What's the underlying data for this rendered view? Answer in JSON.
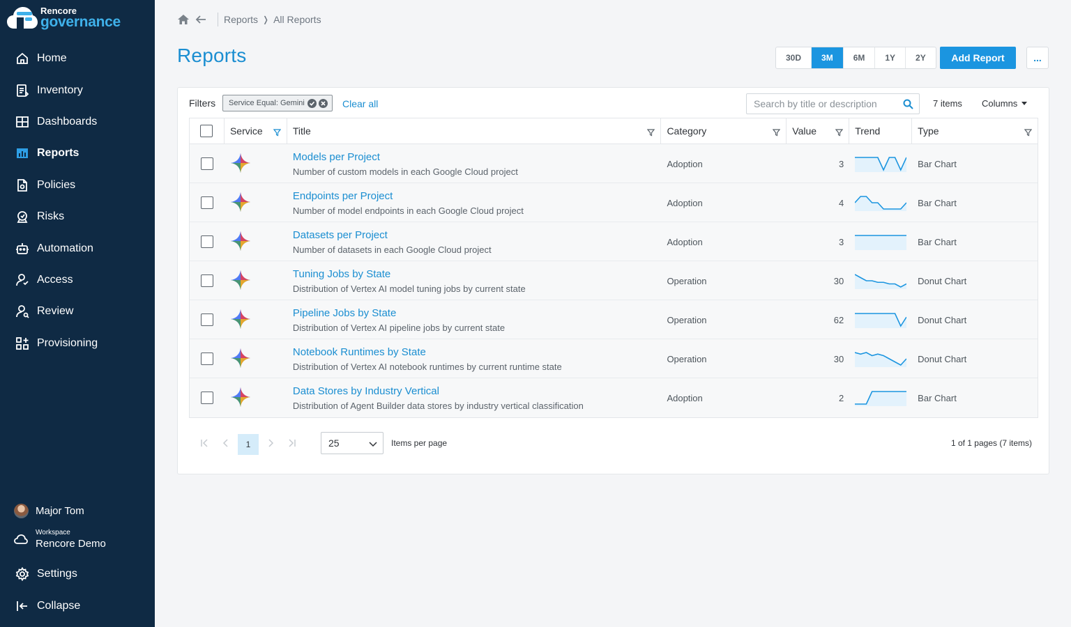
{
  "app": {
    "brand_top": "Rencore",
    "brand_bottom": "governance",
    "accent": "#1b95e0",
    "sidebar_bg": "#0f2a44"
  },
  "sidebar": {
    "items": [
      {
        "label": "Home",
        "icon": "home-icon"
      },
      {
        "label": "Inventory",
        "icon": "inventory-icon"
      },
      {
        "label": "Dashboards",
        "icon": "dashboards-icon"
      },
      {
        "label": "Reports",
        "icon": "reports-icon",
        "active": true
      },
      {
        "label": "Policies",
        "icon": "policies-icon"
      },
      {
        "label": "Risks",
        "icon": "risks-icon"
      },
      {
        "label": "Automation",
        "icon": "automation-icon"
      },
      {
        "label": "Access",
        "icon": "access-icon"
      },
      {
        "label": "Review",
        "icon": "review-icon"
      },
      {
        "label": "Provisioning",
        "icon": "provisioning-icon"
      }
    ],
    "user": "Major Tom",
    "workspace_label": "Workspace",
    "workspace_name": "Rencore Demo",
    "settings": "Settings",
    "collapse": "Collapse"
  },
  "breadcrumb": {
    "root": "Reports",
    "current": "All Reports"
  },
  "page": {
    "title": "Reports",
    "ranges": [
      "30D",
      "3M",
      "6M",
      "1Y",
      "2Y"
    ],
    "active_range": "3M",
    "add_label": "Add Report",
    "more_label": "..."
  },
  "toolbar": {
    "filters_label": "Filters",
    "chip_label": "Service Equal: Gemini",
    "clear_all": "Clear all",
    "search_placeholder": "Search by title or description",
    "items_count": "7 items",
    "columns_label": "Columns"
  },
  "table": {
    "headers": {
      "service": "Service",
      "title": "Title",
      "category": "Category",
      "value": "Value",
      "trend": "Trend",
      "type": "Type"
    },
    "rows": [
      {
        "title": "Models per Project",
        "desc": "Number of custom models in each Google Cloud project",
        "category": "Adoption",
        "value": "3",
        "type": "Bar Chart",
        "trend": [
          3,
          3,
          3,
          3,
          3,
          2,
          3,
          3,
          2,
          3
        ]
      },
      {
        "title": "Endpoints per Project",
        "desc": "Number of model endpoints in each Google Cloud project",
        "category": "Adoption",
        "value": "4",
        "type": "Bar Chart",
        "trend": [
          3,
          4,
          4,
          3,
          3,
          2,
          2,
          2,
          2,
          3
        ]
      },
      {
        "title": "Datasets per Project",
        "desc": "Number of datasets in each Google Cloud project",
        "category": "Adoption",
        "value": "3",
        "type": "Bar Chart",
        "trend": [
          3,
          3,
          3,
          3,
          3,
          3,
          3,
          3,
          3,
          3
        ]
      },
      {
        "title": "Tuning Jobs by State",
        "desc": "Distribution of Vertex AI model tuning jobs by current state",
        "category": "Operation",
        "value": "30",
        "type": "Donut Chart",
        "trend": [
          36,
          34,
          32,
          32,
          31,
          31,
          30,
          30,
          28,
          30
        ]
      },
      {
        "title": "Pipeline Jobs by State",
        "desc": "Distribution of Vertex AI pipeline jobs by current state",
        "category": "Operation",
        "value": "62",
        "type": "Donut Chart",
        "trend": [
          76,
          76,
          76,
          76,
          76,
          76,
          76,
          76,
          62,
          72
        ]
      },
      {
        "title": "Notebook Runtimes by State",
        "desc": "Distribution of Vertex AI notebook runtimes by current runtime state",
        "category": "Operation",
        "value": "30",
        "type": "Donut Chart",
        "trend": [
          38,
          37,
          38,
          36,
          37,
          36,
          34,
          32,
          30,
          34
        ]
      },
      {
        "title": "Data Stores by Industry Vertical",
        "desc": "Distribution of Agent Builder data stores by industry vertical classification",
        "category": "Adoption",
        "value": "2",
        "type": "Bar Chart",
        "trend": [
          1,
          1,
          1,
          2,
          2,
          2,
          2,
          2,
          2,
          2
        ]
      }
    ]
  },
  "pager": {
    "current_page": "1",
    "per_page": "25",
    "per_page_label": "Items per page",
    "info": "1 of 1 pages (7 items)"
  }
}
